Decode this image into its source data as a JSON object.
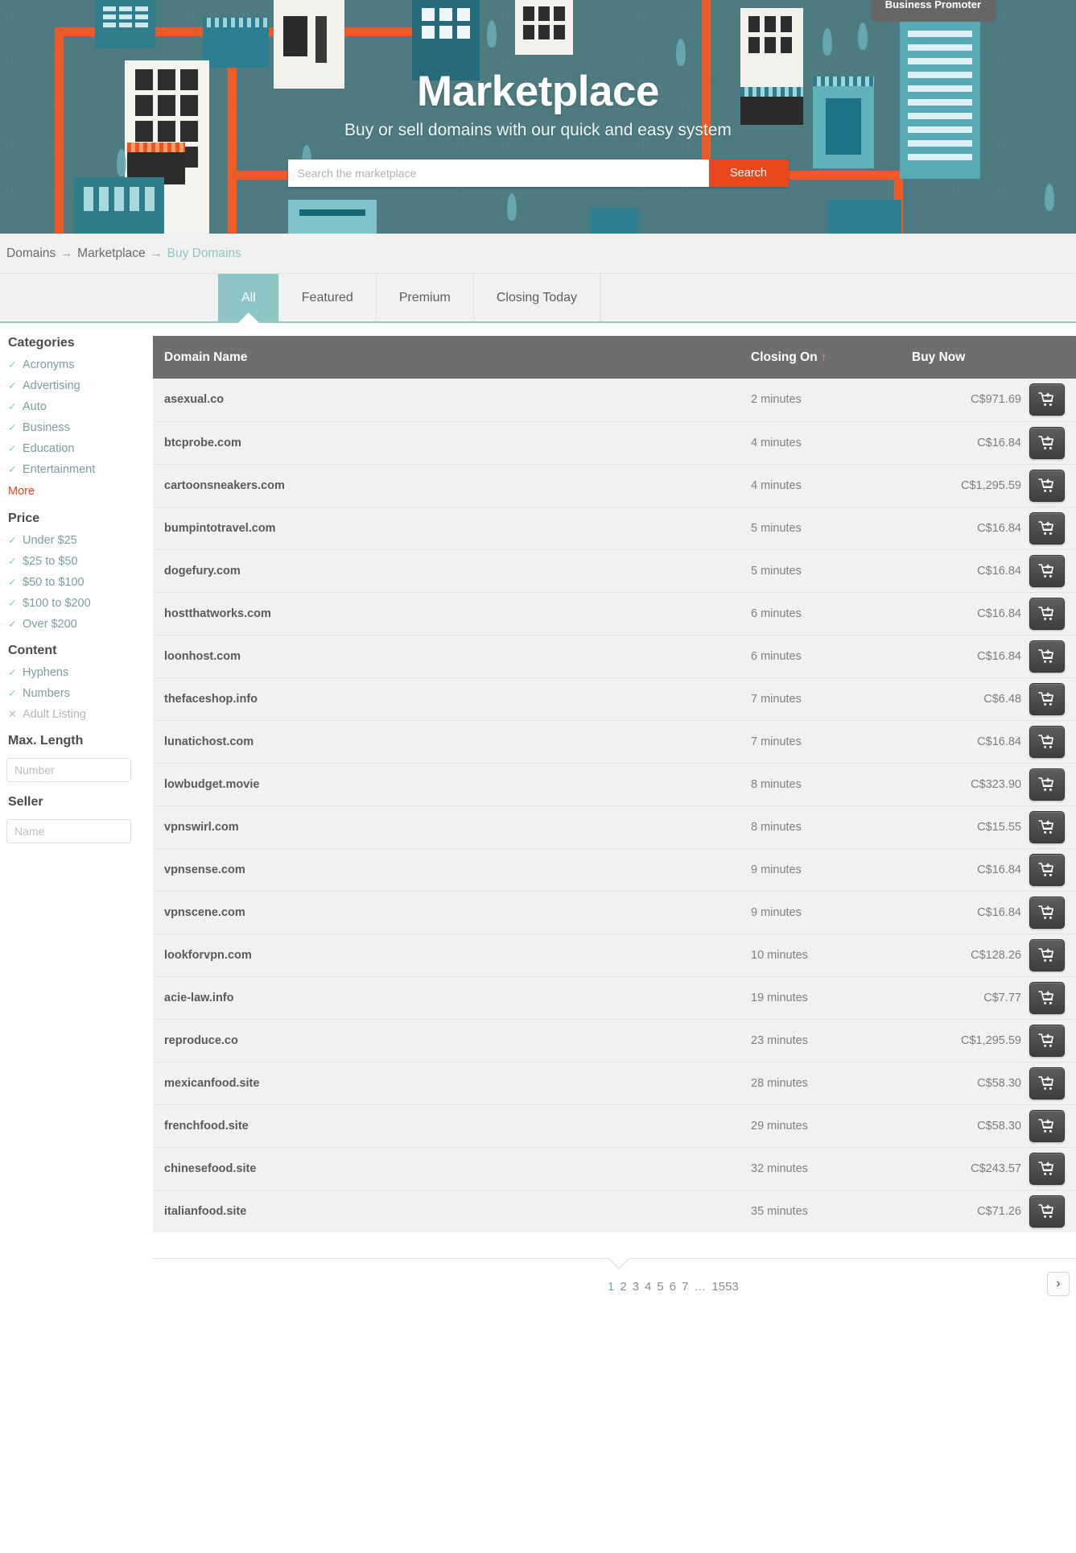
{
  "hero": {
    "badge": "Business Promoter",
    "title": "Marketplace",
    "subtitle": "Buy or sell domains with our quick and easy system",
    "search_placeholder": "Search the marketplace",
    "search_value": "",
    "search_button": "Search"
  },
  "breadcrumb": {
    "items": [
      "Domains",
      "Marketplace",
      "Buy Domains"
    ],
    "separator": "→"
  },
  "tabs": [
    {
      "label": "All",
      "active": true
    },
    {
      "label": "Featured",
      "active": false
    },
    {
      "label": "Premium",
      "active": false
    },
    {
      "label": "Closing Today",
      "active": false
    }
  ],
  "sidebar": {
    "categories_heading": "Categories",
    "categories": [
      {
        "label": "Acronyms",
        "state": "check"
      },
      {
        "label": "Advertising",
        "state": "check"
      },
      {
        "label": "Auto",
        "state": "check"
      },
      {
        "label": "Business",
        "state": "check"
      },
      {
        "label": "Education",
        "state": "check"
      },
      {
        "label": "Entertainment",
        "state": "check"
      }
    ],
    "more_label": "More",
    "price_heading": "Price",
    "price": [
      {
        "label": "Under $25",
        "state": "check"
      },
      {
        "label": "$25 to $50",
        "state": "check"
      },
      {
        "label": "$50 to $100",
        "state": "check"
      },
      {
        "label": "$100 to $200",
        "state": "check"
      },
      {
        "label": "Over $200",
        "state": "check"
      }
    ],
    "content_heading": "Content",
    "content": [
      {
        "label": "Hyphens",
        "state": "check"
      },
      {
        "label": "Numbers",
        "state": "check"
      },
      {
        "label": "Adult Listing",
        "state": "cross"
      }
    ],
    "max_length_heading": "Max. Length",
    "max_length_placeholder": "Number",
    "max_length_value": "",
    "seller_heading": "Seller",
    "seller_placeholder": "Name",
    "seller_value": ""
  },
  "table": {
    "columns": [
      "Domain Name",
      "Closing On",
      "Buy Now"
    ],
    "sort_indicator": "↑",
    "cart_icon": "add-to-cart-icon",
    "rows": [
      {
        "domain": "asexual.co",
        "closing": "2 minutes",
        "price": "C$971.69"
      },
      {
        "domain": "btcprobe.com",
        "closing": "4 minutes",
        "price": "C$16.84"
      },
      {
        "domain": "cartoonsneakers.com",
        "closing": "4 minutes",
        "price": "C$1,295.59"
      },
      {
        "domain": "bumpintotravel.com",
        "closing": "5 minutes",
        "price": "C$16.84"
      },
      {
        "domain": "dogefury.com",
        "closing": "5 minutes",
        "price": "C$16.84"
      },
      {
        "domain": "hostthatworks.com",
        "closing": "6 minutes",
        "price": "C$16.84"
      },
      {
        "domain": "loonhost.com",
        "closing": "6 minutes",
        "price": "C$16.84"
      },
      {
        "domain": "thefaceshop.info",
        "closing": "7 minutes",
        "price": "C$6.48"
      },
      {
        "domain": "lunatichost.com",
        "closing": "7 minutes",
        "price": "C$16.84"
      },
      {
        "domain": "lowbudget.movie",
        "closing": "8 minutes",
        "price": "C$323.90"
      },
      {
        "domain": "vpnswirl.com",
        "closing": "8 minutes",
        "price": "C$15.55"
      },
      {
        "domain": "vpnsense.com",
        "closing": "9 minutes",
        "price": "C$16.84"
      },
      {
        "domain": "vpnscene.com",
        "closing": "9 minutes",
        "price": "C$16.84"
      },
      {
        "domain": "lookforvpn.com",
        "closing": "10 minutes",
        "price": "C$128.26"
      },
      {
        "domain": "acie-law.info",
        "closing": "19 minutes",
        "price": "C$7.77"
      },
      {
        "domain": "reproduce.co",
        "closing": "23 minutes",
        "price": "C$1,295.59"
      },
      {
        "domain": "mexicanfood.site",
        "closing": "28 minutes",
        "price": "C$58.30"
      },
      {
        "domain": "frenchfood.site",
        "closing": "29 minutes",
        "price": "C$58.30"
      },
      {
        "domain": "chinesefood.site",
        "closing": "32 minutes",
        "price": "C$243.57"
      },
      {
        "domain": "italianfood.site",
        "closing": "35 minutes",
        "price": "C$71.26"
      }
    ]
  },
  "pagination": {
    "pages": [
      "1",
      "2",
      "3",
      "4",
      "5",
      "6",
      "7",
      "…",
      "1553"
    ],
    "active": "1",
    "next_label": "›"
  },
  "colors": {
    "teal": "#8dc6c4",
    "orange": "#e8481c",
    "header_gray": "#6e6e6e",
    "hero_bg": "#4d7b7f"
  }
}
